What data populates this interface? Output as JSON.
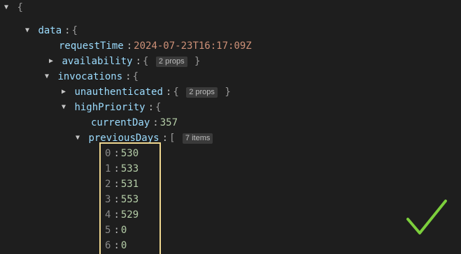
{
  "root": {
    "open_brace": "{"
  },
  "data_node": {
    "key": "data",
    "open_brace": "{"
  },
  "request_time": {
    "key": "requestTime",
    "value": "2024-07-23T16:17:09Z"
  },
  "availability": {
    "key": "availability",
    "open_brace": "{",
    "badge": "2 props",
    "close_brace": "}"
  },
  "invocations": {
    "key": "invocations",
    "open_brace": "{"
  },
  "unauthenticated": {
    "key": "unauthenticated",
    "open_brace": "{",
    "badge": "2 props",
    "close_brace": "}"
  },
  "high_priority": {
    "key": "highPriority",
    "open_brace": "{"
  },
  "current_day": {
    "key": "currentDay",
    "value": "357"
  },
  "previous_days": {
    "key": "previousDays",
    "open_bracket": "[",
    "badge": "7 items",
    "items": [
      {
        "index": "0",
        "value": "530"
      },
      {
        "index": "1",
        "value": "533"
      },
      {
        "index": "2",
        "value": "531"
      },
      {
        "index": "3",
        "value": "553"
      },
      {
        "index": "4",
        "value": "529"
      },
      {
        "index": "5",
        "value": "0"
      },
      {
        "index": "6",
        "value": "0"
      }
    ]
  },
  "separator": ":",
  "colors": {
    "highlight_box": "#f0d890",
    "checkmark": "#7ccf3c"
  },
  "icons": {
    "expanded": "caret-down-icon",
    "collapsed": "caret-right-icon",
    "overlay": "checkmark-icon"
  }
}
